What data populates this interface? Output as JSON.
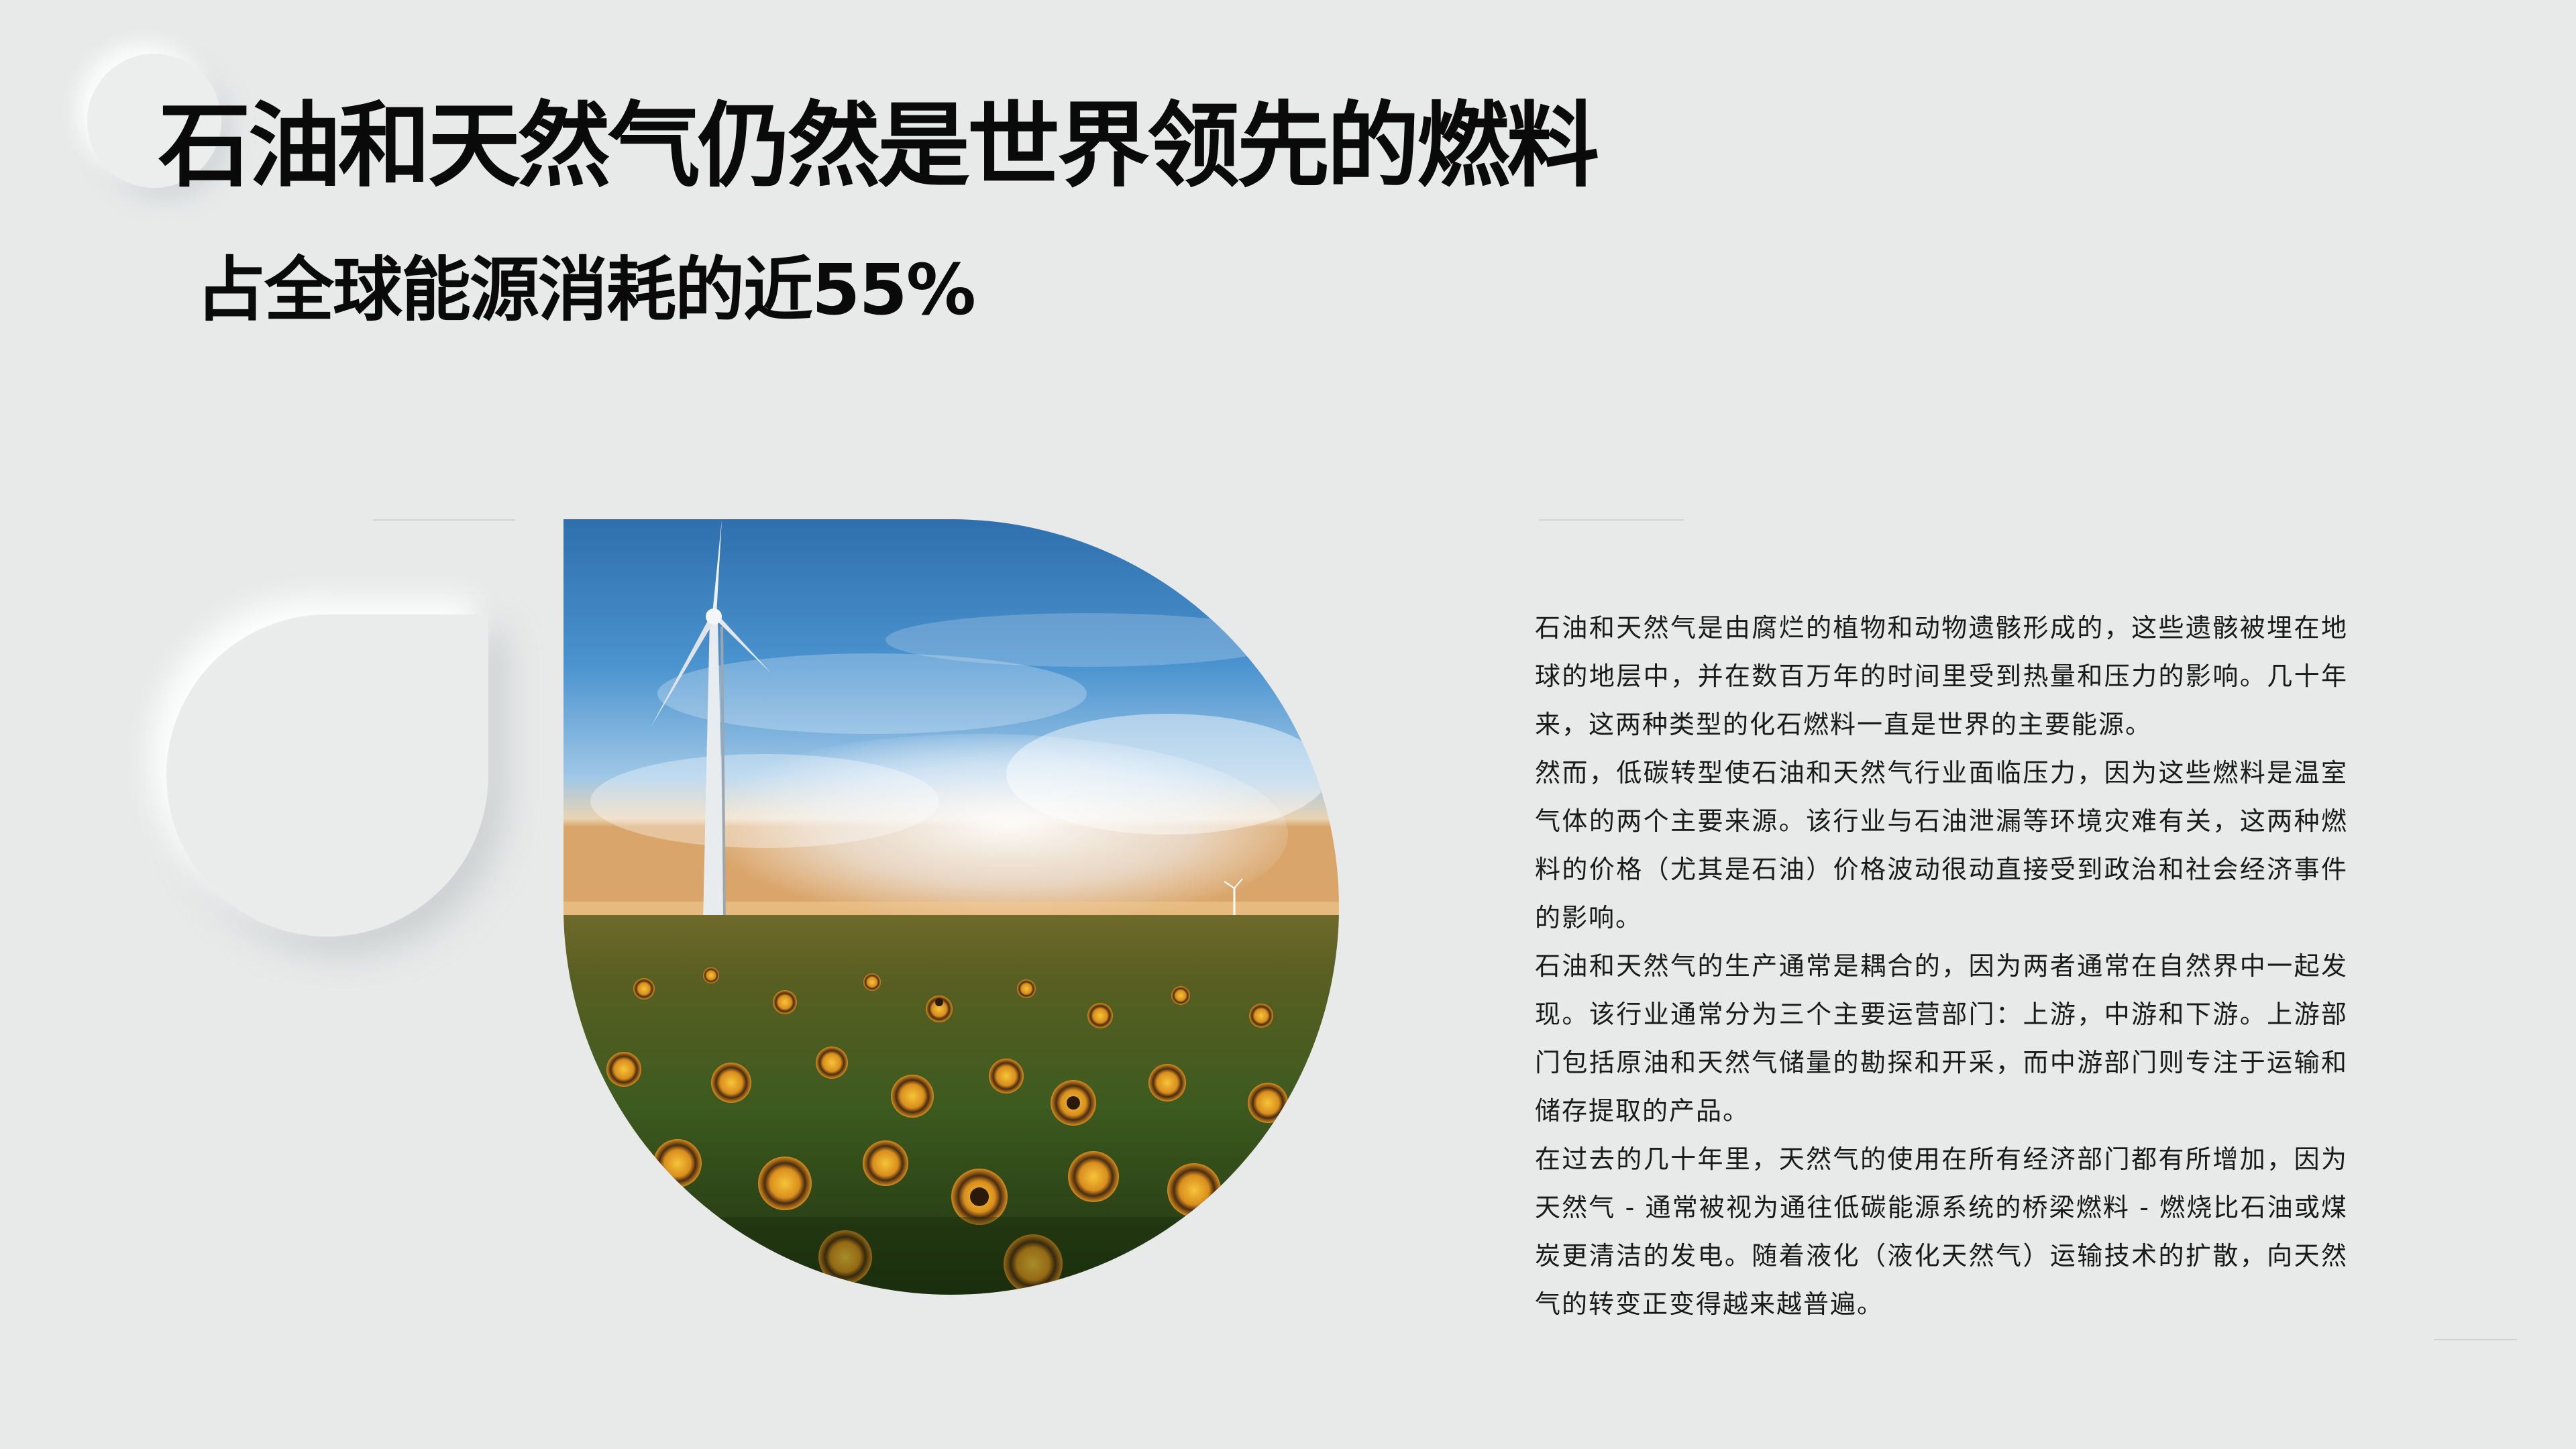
{
  "slide": {
    "title": "石油和天然气仍然是世界领先的燃料",
    "subtitle": "占全球能源消耗的近55%",
    "image": {
      "subject": "wind-turbine-sunflower-field",
      "sky_color": "#3f86c6",
      "field_color": "#3c5a1e"
    },
    "paragraphs": [
      "石油和天然气是由腐烂的植物和动物遗骸形成的，这些遗骸被埋在地球的地层中，并在数百万年的时间里受到热量和压力的影响。几十年来，这两种类型的化石燃料一直是世界的主要能源。",
      "然而，低碳转型使石油和天然气行业面临压力，因为这些燃料是温室气体的两个主要来源。该行业与石油泄漏等环境灾难有关，这两种燃料的价格（尤其是石油）价格波动很动直接受到政治和社会经济事件的影响。",
      "石油和天然气的生产通常是耦合的，因为两者通常在自然界中一起发现。该行业通常分为三个主要运营部门：上游，中游和下游。上游部门包括原油和天然气储量的勘探和开采，而中游部门则专注于运输和储存提取的产品。",
      "在过去的几十年里，天然气的使用在所有经济部门都有所增加，因为天然气 - 通常被视为通往低碳能源系统的桥梁燃料 - 燃烧比石油或煤炭更清洁的发电。随着液化（液化天然气）运输技术的扩散，向天然气的转变正变得越来越普遍。"
    ]
  }
}
